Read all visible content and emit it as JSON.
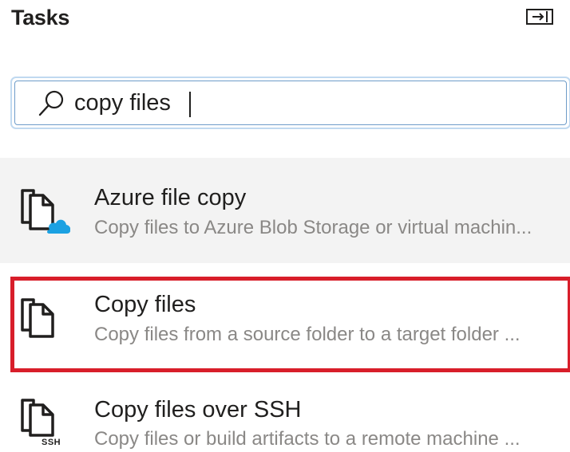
{
  "header": {
    "title": "Tasks",
    "panel_icon": "collapse-panel-icon"
  },
  "search": {
    "value": "copy files",
    "icon": "search-icon"
  },
  "tasks": [
    {
      "title": "Azure file copy",
      "description": "Copy files to Azure Blob Storage or virtual machin...",
      "icon": "azure-file-copy-icon",
      "shaded": true
    },
    {
      "title": "Copy files",
      "description": "Copy files from a source folder to a target folder ...",
      "icon": "copy-files-icon",
      "highlighted": true
    },
    {
      "title": "Copy files over SSH",
      "description": "Copy files or build artifacts to a remote machine ...",
      "icon": "copy-files-ssh-icon",
      "icon_badge": "SSH"
    }
  ],
  "colors": {
    "highlight_border": "#d81e2a",
    "search_border": "#6e9cc9",
    "azure_cloud": "#1ba1e2",
    "shaded_row": "#f3f3f3",
    "secondary_text": "#8a8886"
  }
}
